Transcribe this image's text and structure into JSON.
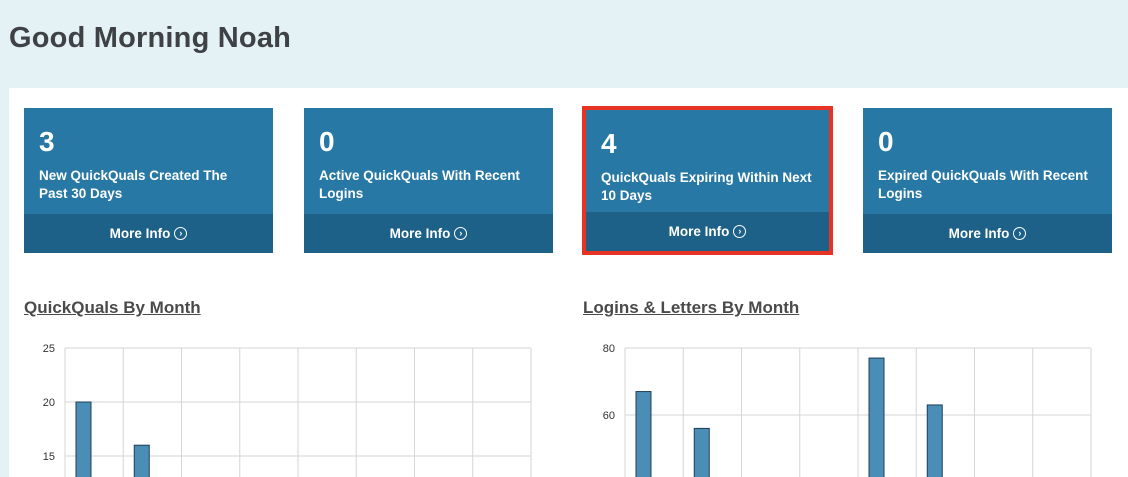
{
  "header": {
    "greeting": "Good Morning Noah"
  },
  "cards": [
    {
      "count": "3",
      "description": "New QuickQuals Created The Past 30 Days",
      "more_label": "More Info",
      "highlighted": false
    },
    {
      "count": "0",
      "description": "Active QuickQuals With Recent Logins",
      "more_label": "More Info",
      "highlighted": false
    },
    {
      "count": "4",
      "description": "QuickQuals Expiring Within Next 10 Days",
      "more_label": "More Info",
      "highlighted": true
    },
    {
      "count": "0",
      "description": "Expired QuickQuals With Recent Logins",
      "more_label": "More Info",
      "highlighted": false
    }
  ],
  "colors": {
    "card_bg": "#2878a5",
    "card_footer": "#1e6188",
    "highlight_border": "#e63323",
    "bar_fill": "#4a8db7"
  },
  "icons": {
    "more_info": "arrow-circle-right-icon"
  },
  "chart_data": [
    {
      "type": "bar",
      "title": "QuickQuals By Month",
      "yticks": [
        25,
        20,
        15
      ],
      "ylim": [
        10,
        25
      ],
      "categories": [
        "",
        "",
        "",
        "",
        "",
        "",
        "",
        ""
      ],
      "values": [
        20,
        16,
        null,
        null,
        null,
        null,
        null,
        null
      ],
      "grid": true
    },
    {
      "type": "bar",
      "title": "Logins & Letters By Month",
      "yticks": [
        80,
        60
      ],
      "ylim": [
        40,
        80
      ],
      "categories": [
        "",
        "",
        "",
        "",
        "",
        "",
        "",
        ""
      ],
      "values": [
        67,
        56,
        null,
        null,
        77,
        63,
        null,
        null
      ],
      "grid": true
    }
  ]
}
